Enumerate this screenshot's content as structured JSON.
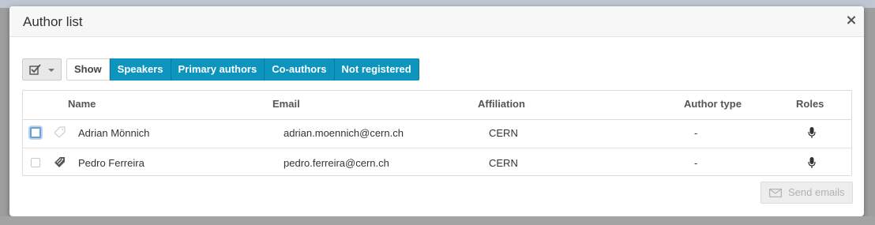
{
  "dialog": {
    "title": "Author list",
    "close_symbol": "×"
  },
  "toolbar": {
    "select_icon": "checkbox-icon",
    "show_label": "Show",
    "filters": [
      "Speakers",
      "Primary authors",
      "Co-authors",
      "Not registered"
    ],
    "accent_color": "#0d94bf"
  },
  "table": {
    "headers": {
      "name": "Name",
      "email": "Email",
      "affiliation": "Affiliation",
      "author_type": "Author type",
      "roles": "Roles"
    },
    "rows": [
      {
        "name": "Adrian Mönnich",
        "email": "adrian.moennich@cern.ch",
        "affiliation": "CERN",
        "author_type": "-",
        "role_icon": "microphone-icon",
        "tag_icon": "tag-icon-faded"
      },
      {
        "name": "Pedro Ferreira",
        "email": "pedro.ferreira@cern.ch",
        "affiliation": "CERN",
        "author_type": "-",
        "role_icon": "microphone-icon",
        "tag_icon": "tag-icon"
      }
    ]
  },
  "footer": {
    "send_emails_label": "Send emails",
    "send_icon": "envelope-icon"
  }
}
